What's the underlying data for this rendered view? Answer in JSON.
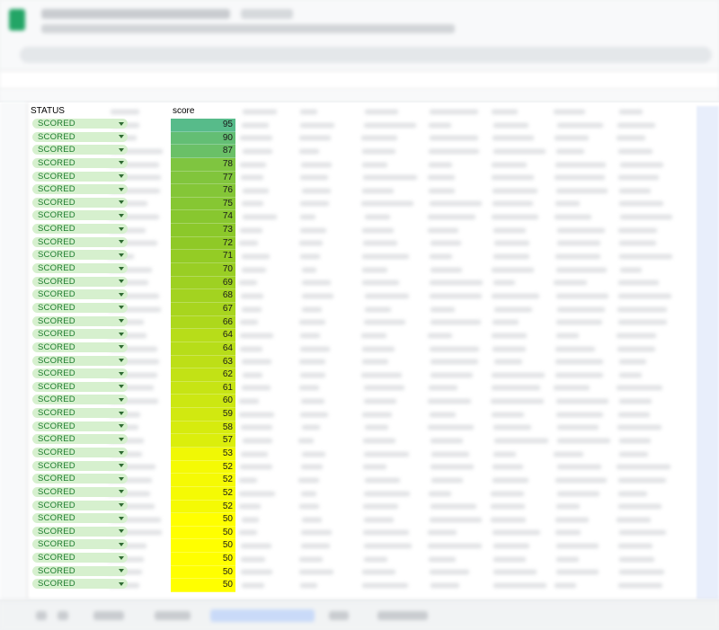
{
  "status_column": {
    "header": "STATUS",
    "dropdown_value": "SCORED",
    "chip_color": "#d6f0ce",
    "text_color": "#1e7d2f"
  },
  "score_column": {
    "header": "score",
    "scale_low_color": "#ffff00",
    "scale_high_color": "#57bb8a"
  },
  "rows": [
    {
      "status": "SCORED",
      "score": "95"
    },
    {
      "status": "SCORED",
      "score": "90"
    },
    {
      "status": "SCORED",
      "score": "87"
    },
    {
      "status": "SCORED",
      "score": "78"
    },
    {
      "status": "SCORED",
      "score": "77"
    },
    {
      "status": "SCORED",
      "score": "76"
    },
    {
      "status": "SCORED",
      "score": "75"
    },
    {
      "status": "SCORED",
      "score": "74"
    },
    {
      "status": "SCORED",
      "score": "73"
    },
    {
      "status": "SCORED",
      "score": "72"
    },
    {
      "status": "SCORED",
      "score": "71"
    },
    {
      "status": "SCORED",
      "score": "70"
    },
    {
      "status": "SCORED",
      "score": "69"
    },
    {
      "status": "SCORED",
      "score": "68"
    },
    {
      "status": "SCORED",
      "score": "67"
    },
    {
      "status": "SCORED",
      "score": "66"
    },
    {
      "status": "SCORED",
      "score": "64"
    },
    {
      "status": "SCORED",
      "score": "64"
    },
    {
      "status": "SCORED",
      "score": "63"
    },
    {
      "status": "SCORED",
      "score": "62"
    },
    {
      "status": "SCORED",
      "score": "61"
    },
    {
      "status": "SCORED",
      "score": "60"
    },
    {
      "status": "SCORED",
      "score": "59"
    },
    {
      "status": "SCORED",
      "score": "58"
    },
    {
      "status": "SCORED",
      "score": "57"
    },
    {
      "status": "SCORED",
      "score": "53"
    },
    {
      "status": "SCORED",
      "score": "52"
    },
    {
      "status": "SCORED",
      "score": "52"
    },
    {
      "status": "SCORED",
      "score": "52"
    },
    {
      "status": "SCORED",
      "score": "52"
    },
    {
      "status": "SCORED",
      "score": "50"
    },
    {
      "status": "SCORED",
      "score": "50"
    },
    {
      "status": "SCORED",
      "score": "50"
    },
    {
      "status": "SCORED",
      "score": "50"
    },
    {
      "status": "SCORED",
      "score": "50"
    },
    {
      "status": "SCORED",
      "score": "50"
    }
  ],
  "icons": {
    "app": "sheets-logo-icon",
    "dropdown": "chevron-down-icon"
  }
}
